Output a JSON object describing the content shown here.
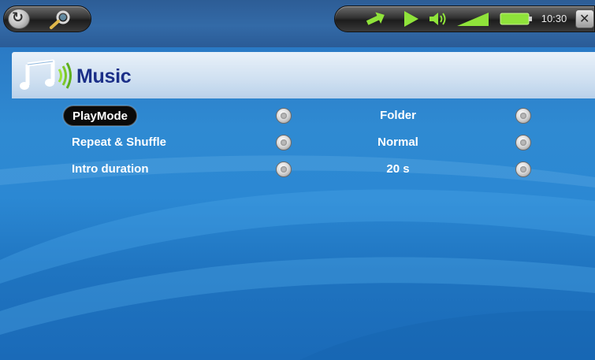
{
  "status_bar": {
    "time": "10:30"
  },
  "header": {
    "title": "Music"
  },
  "settings": [
    {
      "label": "PlayMode",
      "value": "Folder",
      "selected": true
    },
    {
      "label": "Repeat & Shuffle",
      "value": "Normal",
      "selected": false
    },
    {
      "label": "Intro duration",
      "value": "20 s",
      "selected": false
    }
  ],
  "icons": {
    "top_left": [
      "sync-icon",
      "search-icon"
    ],
    "status": [
      "transfer-arrows-icon",
      "play-icon",
      "speaker-icon",
      "volume-level-icon",
      "battery-icon",
      "close-icon"
    ],
    "header": "music-note-icon"
  },
  "colors": {
    "background": "#2b88d3",
    "title_band": "#d4e3f2",
    "title_text": "#1b2f88",
    "status_green": "#8fe33a",
    "selection": "#0a0a0a"
  }
}
